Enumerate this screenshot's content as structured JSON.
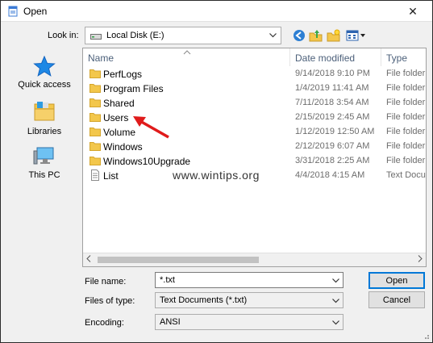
{
  "window": {
    "title": "Open",
    "close_glyph": "✕"
  },
  "lookin": {
    "label": "Look in:",
    "value": "Local Disk (E:)"
  },
  "toolbar": [
    "back-icon",
    "up-folder-icon",
    "new-folder-icon",
    "view-menu-icon"
  ],
  "places": [
    {
      "label": "Quick access",
      "icon": "star-icon"
    },
    {
      "label": "Libraries",
      "icon": "libraries-icon"
    },
    {
      "label": "This PC",
      "icon": "computer-icon"
    }
  ],
  "columns": {
    "name": "Name",
    "date": "Date modified",
    "type": "Type"
  },
  "files": [
    {
      "name": "PerfLogs",
      "date": "9/14/2018 9:10 PM",
      "type": "File folder",
      "icon": "folder-icon"
    },
    {
      "name": "Program Files",
      "date": "1/4/2019 11:41 AM",
      "type": "File folder",
      "icon": "folder-icon"
    },
    {
      "name": "Shared",
      "date": "7/11/2018 3:54 AM",
      "type": "File folder",
      "icon": "folder-icon"
    },
    {
      "name": "Users",
      "date": "2/15/2019 2:45 AM",
      "type": "File folder",
      "icon": "folder-icon"
    },
    {
      "name": "Volume",
      "date": "1/12/2019 12:50 AM",
      "type": "File folder",
      "icon": "folder-icon"
    },
    {
      "name": "Windows",
      "date": "2/12/2019 6:07 AM",
      "type": "File folder",
      "icon": "folder-icon"
    },
    {
      "name": "Windows10Upgrade",
      "date": "3/31/2018 2:25 AM",
      "type": "File folder",
      "icon": "folder-icon"
    },
    {
      "name": "List",
      "date": "4/4/2018 4:15 AM",
      "type": "Text Docu",
      "icon": "text-file-icon"
    }
  ],
  "watermark": "www.wintips.org",
  "form": {
    "filename_label": "File name:",
    "filename_value": "*.txt",
    "filetype_label": "Files of type:",
    "filetype_value": "Text Documents (*.txt)",
    "encoding_label": "Encoding:",
    "encoding_value": "ANSI",
    "open_label": "Open",
    "cancel_label": "Cancel"
  },
  "colors": {
    "folder": "#f3c74b",
    "accent": "#0078d7",
    "annotation": "#e01b1b"
  }
}
